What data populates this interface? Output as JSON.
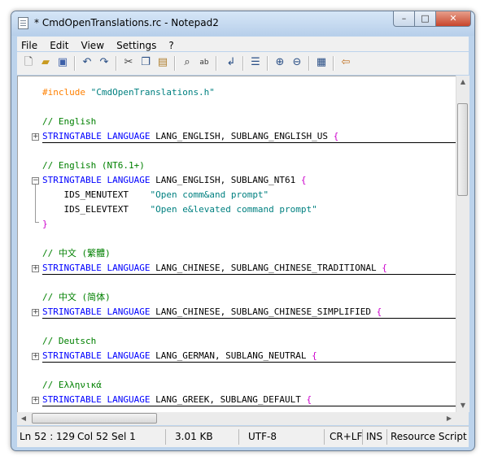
{
  "window": {
    "title": "* CmdOpenTranslations.rc - Notepad2"
  },
  "titlebar": {
    "minimize": "–",
    "maximize": "□",
    "close": "✕"
  },
  "menu": [
    "File",
    "Edit",
    "View",
    "Settings",
    "?"
  ],
  "toolbar": [
    "new-icon",
    "open-icon",
    "save-icon",
    "undo-icon",
    "redo-icon",
    "cut-icon",
    "copy-icon",
    "paste-icon",
    "find-icon",
    "replace-icon",
    "word-wrap-icon",
    "list-icon",
    "zoom-in-icon",
    "zoom-out-icon",
    "view-icon",
    "exit-icon"
  ],
  "code": {
    "l1_pp": "#include",
    "l1_str": "\"CmdOpenTranslations.h\"",
    "c_english": "// English",
    "st": "STRINGTABLE",
    "lang": "LANGUAGE",
    "english_args": "LANG_ENGLISH, SUBLANG_ENGLISH_US",
    "brace_open": "{",
    "brace_close": "}",
    "c_english_nt": "// English (NT6.1+)",
    "english_nt_args": "LANG_ENGLISH, SUBLANG_NT61",
    "ids_menutext": "IDS_MENUTEXT",
    "ids_menutext_val": "\"Open comm&and prompt\"",
    "ids_elevtext": "IDS_ELEVTEXT",
    "ids_elevtext_val": "\"Open e&levated command prompt\"",
    "c_chinese_trad": "// 中文 (繁體)",
    "chinese_trad_args": "LANG_CHINESE, SUBLANG_CHINESE_TRADITIONAL",
    "c_chinese_simp": "// 中文 (简体)",
    "chinese_simp_args": "LANG_CHINESE, SUBLANG_CHINESE_SIMPLIFIED",
    "c_deutsch": "// Deutsch",
    "german_args": "LANG_GERMAN, SUBLANG_NEUTRAL",
    "c_greek": "// Ελληνικά",
    "greek_args": "LANG_GREEK, SUBLANG_DEFAULT"
  },
  "status": {
    "position": "Ln 52 : 129",
    "col": "Col 52",
    "sel": "Sel 1",
    "size": "3.01 KB",
    "encoding": "UTF-8",
    "eol": "CR+LF",
    "mode": "INS",
    "lexer": "Resource Script"
  },
  "colors": {
    "keyword": "#0000ff",
    "comment": "#008000",
    "preprocessor": "#ff8000",
    "string": "#008080",
    "brace": "#cc00cc"
  }
}
